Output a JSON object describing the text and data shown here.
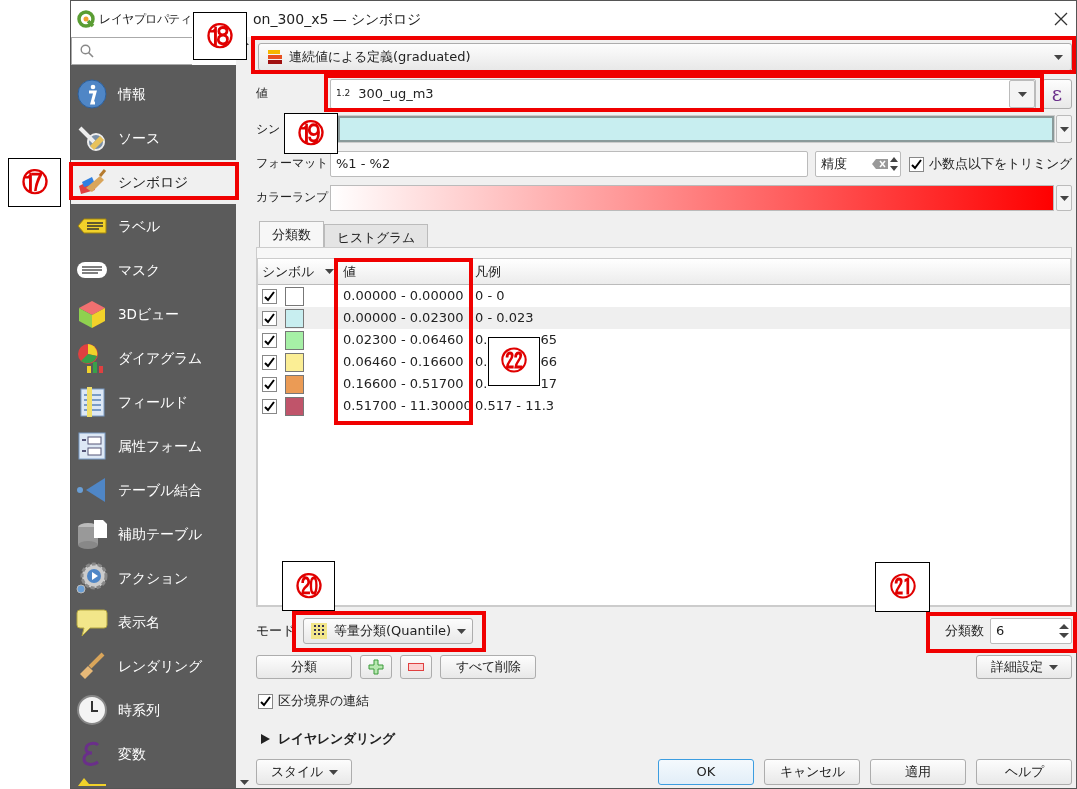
{
  "window": {
    "title_parts": [
      "レイヤプロパティ",
      "on_300_x5 — シンボロジ"
    ]
  },
  "sidebar": {
    "items": [
      {
        "label": "情報",
        "selected": false
      },
      {
        "label": "ソース",
        "selected": false
      },
      {
        "label": "シンボロジ",
        "selected": true
      },
      {
        "label": "ラベル",
        "selected": false
      },
      {
        "label": "マスク",
        "selected": false
      },
      {
        "label": "3Dビュー",
        "selected": false
      },
      {
        "label": "ダイアグラム",
        "selected": false
      },
      {
        "label": "フィールド",
        "selected": false
      },
      {
        "label": "属性フォーム",
        "selected": false
      },
      {
        "label": "テーブル結合",
        "selected": false
      },
      {
        "label": "補助テーブル",
        "selected": false
      },
      {
        "label": "アクション",
        "selected": false
      },
      {
        "label": "表示名",
        "selected": false
      },
      {
        "label": "レンダリング",
        "selected": false
      },
      {
        "label": "時系列",
        "selected": false
      },
      {
        "label": "変数",
        "selected": false
      }
    ]
  },
  "renderer": {
    "value": "連続値による定義(graduated)"
  },
  "value_field": {
    "label": "値",
    "type_badge": "1.2",
    "value": "300_ug_m3",
    "expression_button": "ε"
  },
  "symbol": {
    "label": "シン"
  },
  "format": {
    "label": "フォーマット",
    "value": "%1 - %2",
    "precision": "精度",
    "trim": {
      "label": "小数点以下をトリミング",
      "checked": true
    }
  },
  "color_ramp": {
    "label": "カラーランプ"
  },
  "tabs": [
    {
      "label": "分類数",
      "selected": true
    },
    {
      "label": "ヒストグラム",
      "selected": false
    }
  ],
  "table": {
    "columns": [
      "シンボル",
      "値",
      "凡例"
    ],
    "rows": [
      {
        "checked": true,
        "color": "#ffffff",
        "value": "0.00000 - 0.00000",
        "legend": [
          "0 - 0"
        ]
      },
      {
        "checked": true,
        "color": "#c8eef0",
        "value": "0.00000 - 0.02300",
        "legend": [
          "0 - 0.023"
        ]
      },
      {
        "checked": true,
        "color": "#a6f0a6",
        "value": "0.02300 - 0.06460",
        "legend": [
          "0.",
          "65"
        ]
      },
      {
        "checked": true,
        "color": "#fbee95",
        "value": "0.06460 - 0.16600",
        "legend": [
          "0.",
          "66"
        ]
      },
      {
        "checked": true,
        "color": "#eb9b55",
        "value": "0.16600 - 0.51700",
        "legend": [
          "0.",
          "17"
        ]
      },
      {
        "checked": true,
        "color": "#c0546a",
        "value": "0.51700 - 11.30000",
        "legend": [
          "0.517 - 11.3"
        ]
      }
    ]
  },
  "mode": {
    "label": "モード",
    "value": "等量分類(Quantile)"
  },
  "classes": {
    "label": "分類数",
    "value": "6"
  },
  "actions": {
    "classify": "分類",
    "delete_all": "すべて削除",
    "advanced": "詳細設定"
  },
  "link_boundaries": {
    "label": "区分境界の連結",
    "checked": true
  },
  "layer_rendering": {
    "label": "レイヤレンダリング",
    "expanded": false
  },
  "footer": {
    "style": "スタイル",
    "buttons": [
      {
        "label": "OK",
        "default": true
      },
      {
        "label": "キャンセル",
        "default": false
      },
      {
        "label": "適用",
        "default": false
      },
      {
        "label": "ヘルプ",
        "default": false
      }
    ]
  },
  "callouts": [
    {
      "label": "⑰"
    },
    {
      "label": "⑱"
    },
    {
      "label": "⑲"
    },
    {
      "label": "⑳"
    },
    {
      "label": "㉑"
    },
    {
      "label": "㉒"
    }
  ]
}
